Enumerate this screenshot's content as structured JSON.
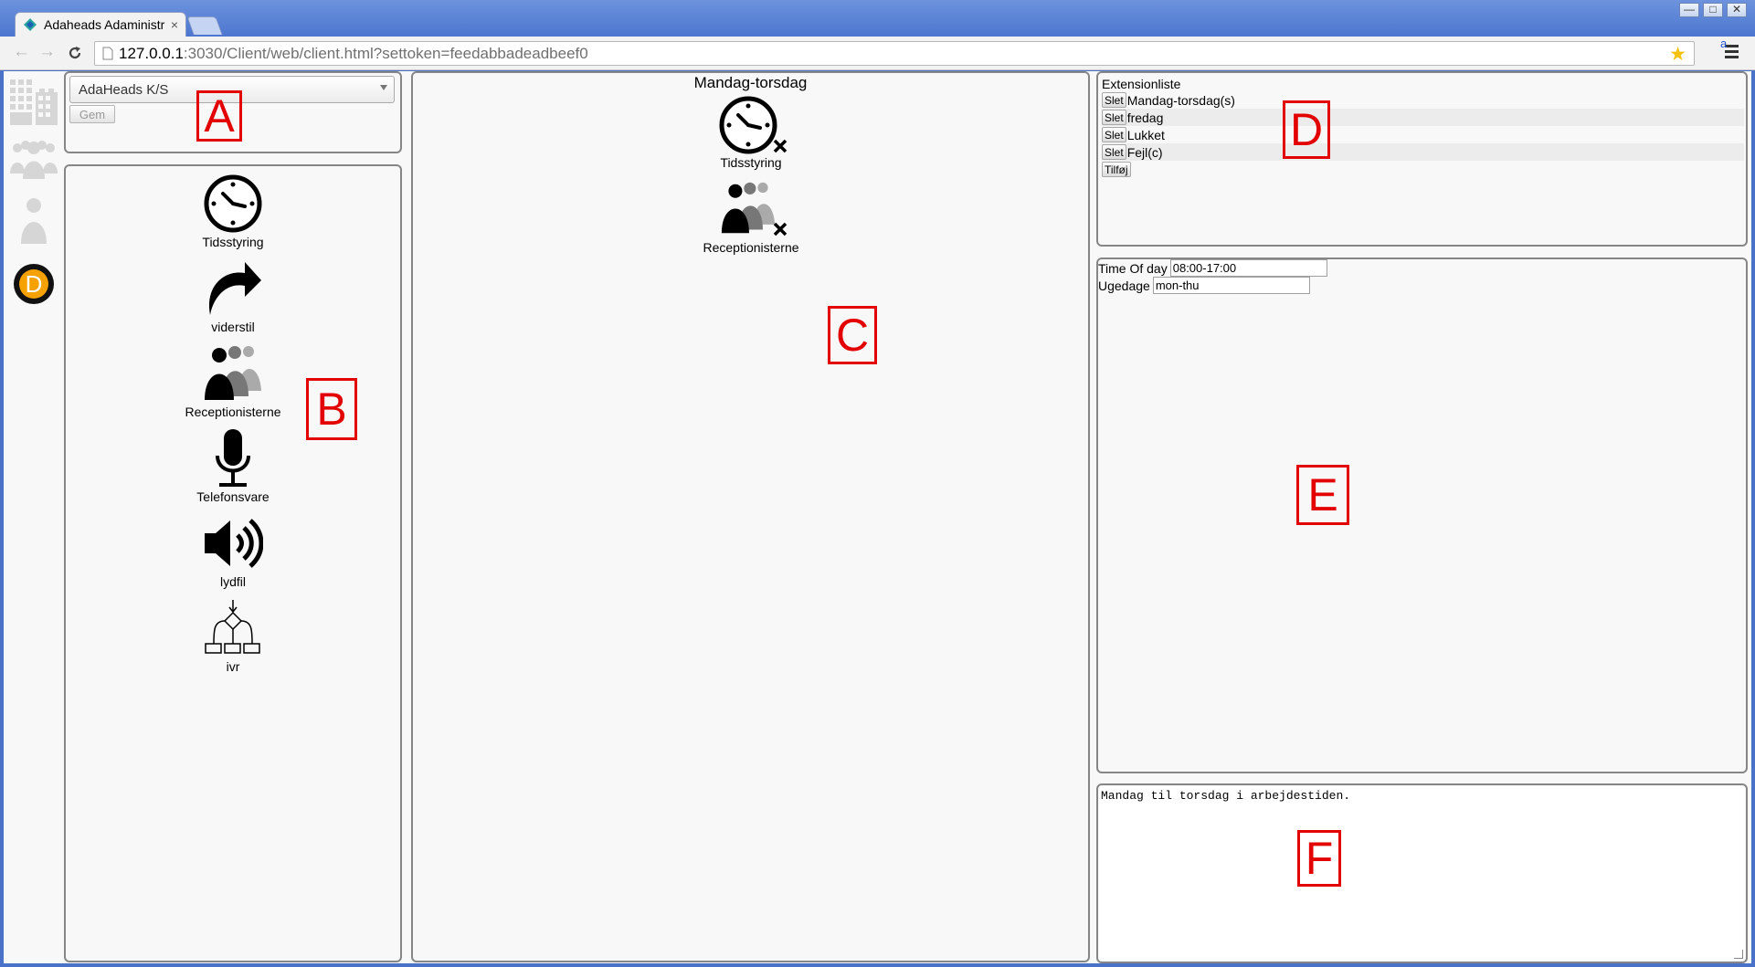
{
  "browser": {
    "tab_title": "Adaheads Adaministr",
    "tab_close": "×",
    "url_host": "127.0.0.1",
    "url_path": ":3030/Client/web/client.html?settoken=feedabbadeadbeef0",
    "ext_letter": "a",
    "win_min": "—",
    "win_max": "□",
    "win_close": "✕"
  },
  "navbar": {
    "items": [
      {
        "name": "organisations",
        "icon": "building-icon"
      },
      {
        "name": "receptions",
        "icon": "people-icon"
      },
      {
        "name": "contacts",
        "icon": "person-icon"
      },
      {
        "name": "dialplan",
        "icon": "dialplan-d-icon",
        "letter": "D",
        "active": true
      }
    ]
  },
  "panel_a": {
    "selected_organisation": "AdaHeads K/S",
    "save_label": "Gem"
  },
  "palette": {
    "items": [
      {
        "label": "Tidsstyring",
        "icon": "clock-icon"
      },
      {
        "label": "viderstil",
        "icon": "forward-arrow-icon"
      },
      {
        "label": "Receptionisterne",
        "icon": "receptionists-icon"
      },
      {
        "label": "Telefonsvare",
        "icon": "microphone-icon"
      },
      {
        "label": "lydfil",
        "icon": "speaker-icon"
      },
      {
        "label": "ivr",
        "icon": "ivr-tree-icon"
      }
    ]
  },
  "dialplan": {
    "title": "Mandag-torsdag",
    "items": [
      {
        "label": "Tidsstyring",
        "icon": "clock-icon"
      },
      {
        "label": "Receptionisterne",
        "icon": "receptionists-icon"
      }
    ]
  },
  "extensions": {
    "title": "Extensionliste",
    "delete_label": "Slet",
    "add_label": "Tilføj",
    "items": [
      "Mandag-torsdag(s)",
      "fredag",
      "Lukket",
      "Fejl(c)"
    ]
  },
  "properties": {
    "time_label": "Time Of day",
    "time_value": "08:00-17:00",
    "weekday_label": "Ugedage",
    "weekday_value": "mon-thu"
  },
  "description": {
    "text": "Mandag til torsdag i arbejdestiden."
  },
  "annotations": [
    "A",
    "B",
    "C",
    "D",
    "E",
    "F"
  ],
  "colors": {
    "annotation": "#e30000",
    "panel_border": "#868686",
    "active_nav": "#f5a200"
  }
}
